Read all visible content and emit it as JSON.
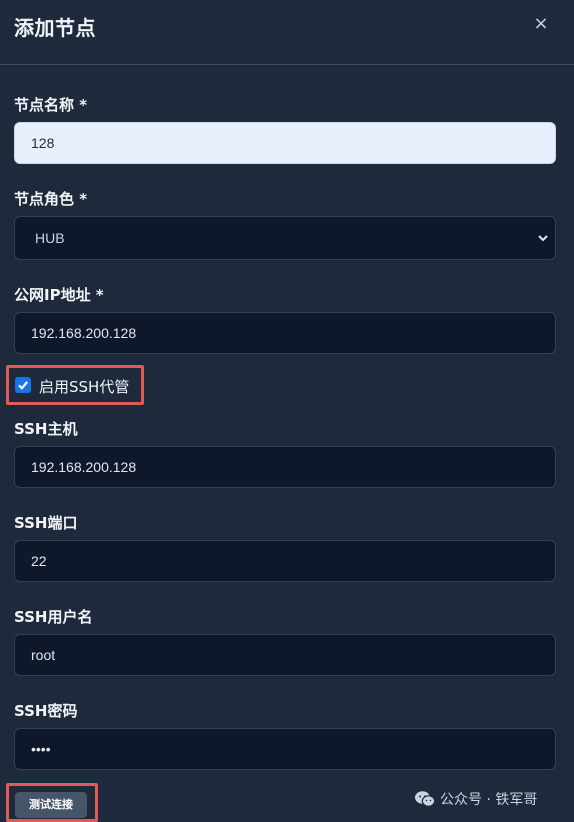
{
  "dialog": {
    "title": "添加节点",
    "close_label": "×"
  },
  "fields": {
    "node_name": {
      "label": "节点名称 *",
      "value": "128"
    },
    "node_role": {
      "label": "节点角色 *",
      "value": "HUB"
    },
    "public_ip": {
      "label": "公网IP地址 *",
      "value": "192.168.200.128"
    },
    "ssh_proxy": {
      "label": "启用SSH代管",
      "checked": true
    },
    "ssh_host": {
      "label": "SSH主机",
      "value": "192.168.200.128"
    },
    "ssh_port": {
      "label": "SSH端口",
      "value": "22"
    },
    "ssh_user": {
      "label": "SSH用户名",
      "value": "root"
    },
    "ssh_password": {
      "label": "SSH密码",
      "value": "••••"
    }
  },
  "actions": {
    "test_connection_label": "测试连接"
  },
  "watermark": {
    "text": "公众号 · 铁军哥",
    "icon": "wechat-icon"
  },
  "colors": {
    "background": "#1e293b",
    "input_bg": "#0f172a",
    "highlight_border": "#e05a5a",
    "checkbox_accent": "#1a73e8"
  }
}
